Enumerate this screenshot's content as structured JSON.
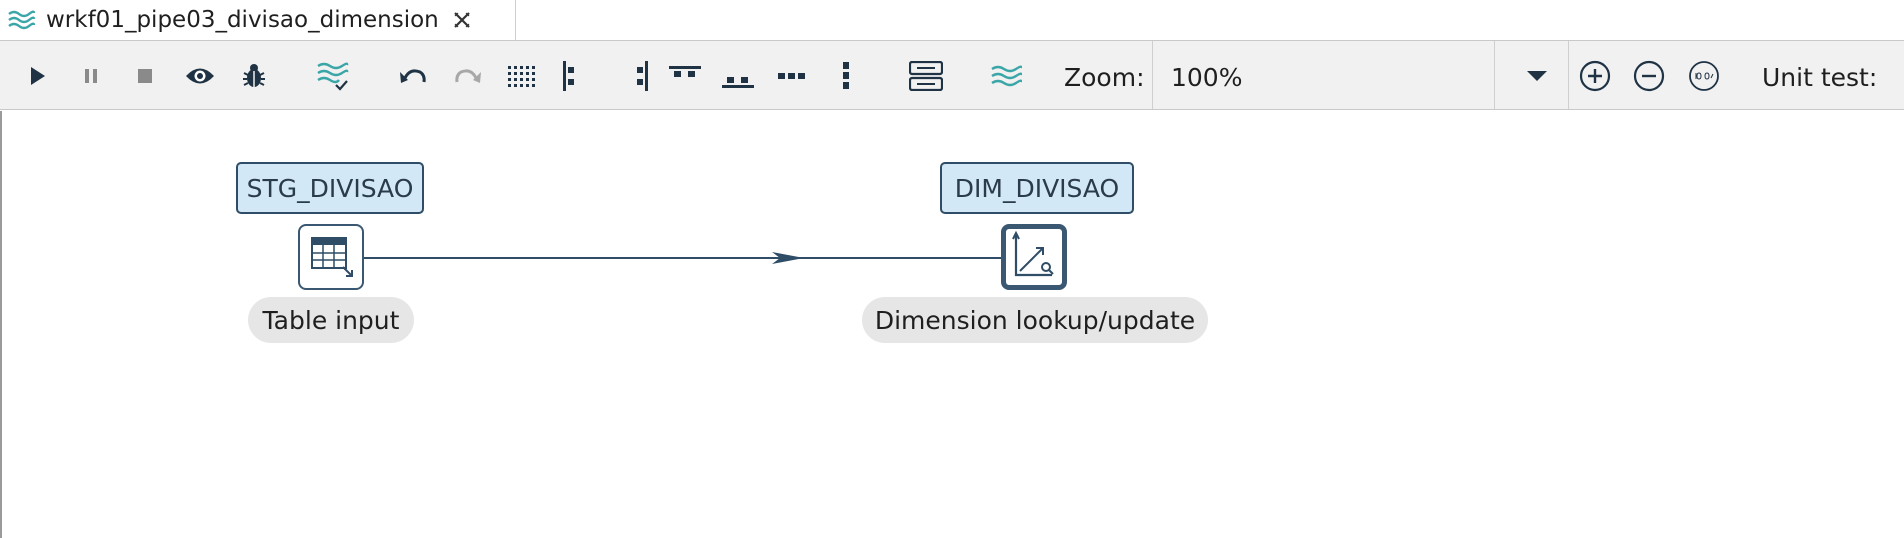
{
  "tab": {
    "title": "wrkf01_pipe03_divisao_dimension",
    "icon": "pipeline-icon",
    "close_icon": "close-icon"
  },
  "toolbar": {
    "buttons": [
      {
        "name": "run-button",
        "icon": "play-icon"
      },
      {
        "name": "pause-button",
        "icon": "pause-icon"
      },
      {
        "name": "stop-button",
        "icon": "stop-icon"
      },
      {
        "name": "preview-button",
        "icon": "eye-icon"
      },
      {
        "name": "debug-button",
        "icon": "bug-icon"
      },
      {
        "name": "check-button",
        "icon": "pipeline-check-icon"
      },
      {
        "name": "undo-button",
        "icon": "undo-icon"
      },
      {
        "name": "redo-button",
        "icon": "redo-icon"
      },
      {
        "name": "snap-grid-button",
        "icon": "grid-icon"
      },
      {
        "name": "align-left-button",
        "icon": "align-left-icon"
      },
      {
        "name": "align-right-button",
        "icon": "align-right-icon"
      },
      {
        "name": "align-top-button",
        "icon": "align-top-icon"
      },
      {
        "name": "align-bottom-button",
        "icon": "align-bottom-icon"
      },
      {
        "name": "distribute-horizontal-button",
        "icon": "distribute-horizontal-icon"
      },
      {
        "name": "distribute-vertical-button",
        "icon": "distribute-vertical-icon"
      },
      {
        "name": "pipeline-properties-button",
        "icon": "properties-icon"
      },
      {
        "name": "pipeline-options-button",
        "icon": "pipeline-icon"
      }
    ],
    "zoom_label": "Zoom:",
    "zoom_value": "100%",
    "zoom_in_icon": "zoom-in-icon",
    "zoom_out_icon": "zoom-out-icon",
    "zoom_100_icon": "zoom-100-icon",
    "unit_test_label": "Unit test:"
  },
  "canvas": {
    "transforms": [
      {
        "title": "STG_DIVISAO",
        "label": "Table input",
        "icon": "table-input-icon",
        "selected": false
      },
      {
        "title": "DIM_DIVISAO",
        "label": "Dimension lookup/update",
        "icon": "dimension-lookup-icon",
        "selected": true
      }
    ],
    "hops": [
      {
        "from": "STG_DIVISAO",
        "to": "DIM_DIVISAO"
      }
    ]
  },
  "colors": {
    "accent_teal": "#3aa6a8",
    "node_border": "#2f4d66",
    "node_title_bg": "#d3e8f6",
    "hop": "#2f4d66"
  }
}
